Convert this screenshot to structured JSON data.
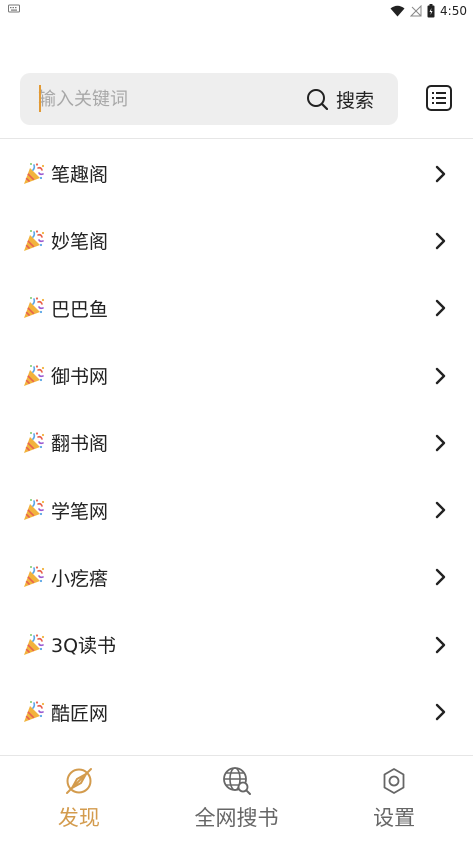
{
  "status_bar": {
    "time": "4:50"
  },
  "search": {
    "placeholder": "输入关键词",
    "button_label": "搜索"
  },
  "sources": [
    {
      "label": "笔趣阁"
    },
    {
      "label": "妙笔阁"
    },
    {
      "label": "巴巴鱼"
    },
    {
      "label": "御书网"
    },
    {
      "label": "翻书阁"
    },
    {
      "label": "学笔网"
    },
    {
      "label": "小疙瘩"
    },
    {
      "label": "3Q读书"
    },
    {
      "label": "酷匠网"
    }
  ],
  "nav": {
    "discover": "发现",
    "search_all": "全网搜书",
    "settings": "设置"
  },
  "colors": {
    "accent": "#d39b4d",
    "search_bg": "#eeeeee"
  }
}
